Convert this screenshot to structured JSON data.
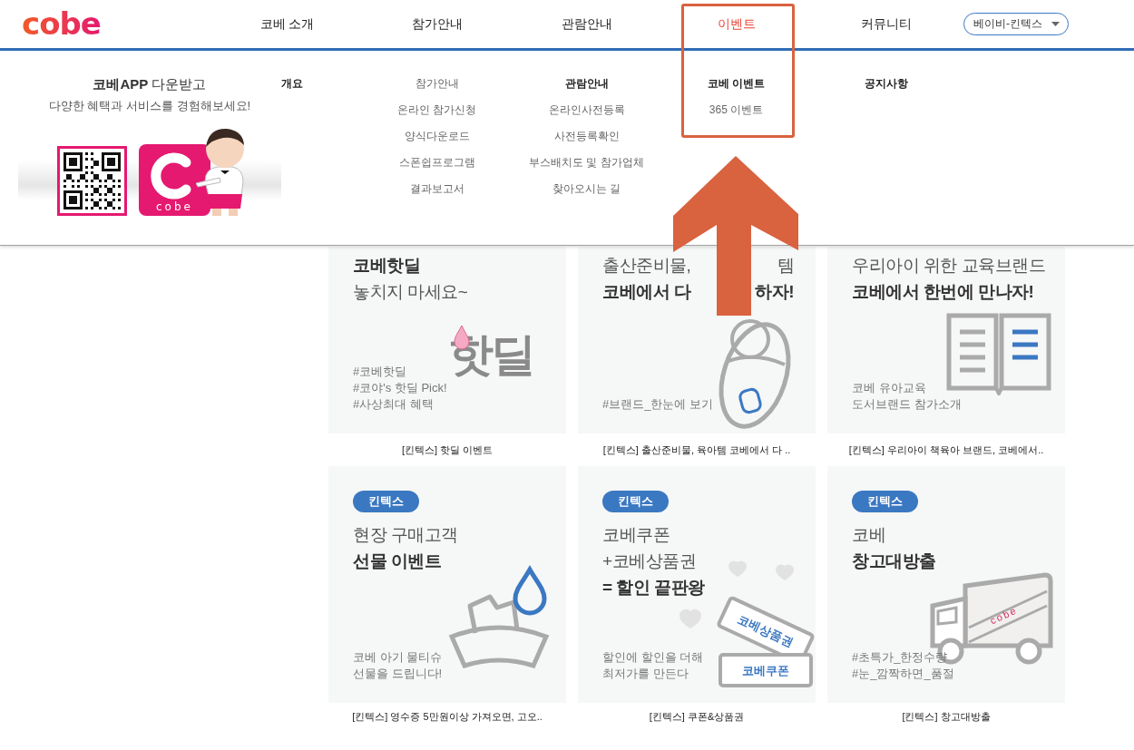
{
  "header": {
    "logo": "cobe",
    "nav": [
      {
        "label": "코베 소개",
        "selected": false
      },
      {
        "label": "참가안내",
        "selected": false
      },
      {
        "label": "관람안내",
        "selected": false
      },
      {
        "label": "이벤트",
        "selected": true
      },
      {
        "label": "커뮤니티",
        "selected": false
      }
    ],
    "venue_select": {
      "value": "베이비-킨텍스"
    }
  },
  "menu": {
    "app_promo": {
      "title": "**코베APP** 다운받고",
      "subtitle": "다양한 혜택과 서비스를 경험해보세요!",
      "app_icon_label": "cobe"
    },
    "columns": [
      {
        "items": [
          {
            "label": "개요",
            "bold": true
          }
        ]
      },
      {
        "items": [
          {
            "label": "참가안내",
            "bold": false
          },
          {
            "label": "온라인 참가신청",
            "bold": false
          },
          {
            "label": "양식다운로드",
            "bold": false
          },
          {
            "label": "스폰쉽프로그램",
            "bold": false
          },
          {
            "label": "결과보고서",
            "bold": false
          }
        ]
      },
      {
        "items": [
          {
            "label": "관람안내",
            "bold": true
          },
          {
            "label": "온라인사전등록",
            "bold": false
          },
          {
            "label": "사전등록확인",
            "bold": false
          },
          {
            "label": "부스배치도 및 참가업체",
            "bold": false
          },
          {
            "label": "찾아오시는 길",
            "bold": false
          }
        ]
      },
      {
        "items": [
          {
            "label": "코베 이벤트",
            "bold": true
          },
          {
            "label": "365 이벤트",
            "bold": false
          }
        ]
      },
      {
        "items": [
          {
            "label": "공지사항",
            "bold": true
          }
        ]
      }
    ]
  },
  "cards": [
    {
      "heading": [
        {
          "text": "코베핫딜",
          "bold": true
        },
        {
          "text": "놓치지 마세요~",
          "bold": false
        }
      ],
      "description": [
        "#코베핫딜",
        "#코야's 핫딜 Pick!",
        "#사상최대 혜택"
      ],
      "illustration": {
        "kind": "hotdeal",
        "labels": [
          "핫딜"
        ]
      },
      "caption": "[킨텍스] 핫딜 이벤트"
    },
    {
      "heading": [
        {
          "parts": [
            "출산준비물,",
            "템"
          ],
          "bold": false
        },
        {
          "parts": [
            "코베에서 다",
            "하자!"
          ],
          "bold": true
        }
      ],
      "description": [
        "#브랜드_한눈에 보기"
      ],
      "illustration": {
        "kind": "baby"
      },
      "caption": "[킨텍스] 출산준비물, 육아템 코베에서 다 .."
    },
    {
      "heading": [
        {
          "text": "우리아이 위한 교육브랜드",
          "bold": false
        },
        {
          "text": "코베에서 한번에 만나자!",
          "bold": true
        }
      ],
      "description": [
        "코베 유아교육",
        "도서브랜드 참가소개"
      ],
      "illustration": {
        "kind": "book"
      },
      "caption": "[킨텍스] 우리아이 책육아 브랜드, 코베에서.."
    },
    {
      "badge": "킨텍스",
      "heading": [
        {
          "text": "현장 구매고객",
          "bold": false
        },
        {
          "text": "선물 이벤트",
          "bold": true
        }
      ],
      "description": [
        "코베 아기 물티슈",
        "선물을 드립니다!"
      ],
      "illustration": {
        "kind": "tissue"
      },
      "caption": "[킨텍스] 영수증 5만원이상 가져오면, 고오.."
    },
    {
      "badge": "킨텍스",
      "heading": [
        {
          "text": "코베쿠폰",
          "bold": false
        },
        {
          "text": "+코베상품권",
          "bold": false
        },
        {
          "text": "= 할인 끝판왕",
          "bold": true
        }
      ],
      "description": [
        "할인에 할인을 더해",
        "최저가를 만든다"
      ],
      "illustration": {
        "kind": "coupons",
        "labels": [
          "코베상품권",
          "코베쿠폰"
        ]
      },
      "caption": "[킨텍스] 쿠폰&상품권"
    },
    {
      "badge": "킨텍스",
      "heading": [
        {
          "text": "코베",
          "bold": false
        },
        {
          "text": "창고대방출",
          "bold": true
        }
      ],
      "description": [
        "#초특가_한정수량",
        "#눈_깜짝하면_품절"
      ],
      "illustration": {
        "kind": "truck",
        "labels": [
          "cobe"
        ]
      },
      "caption": "[킨텍스] 창고대방출"
    }
  ]
}
